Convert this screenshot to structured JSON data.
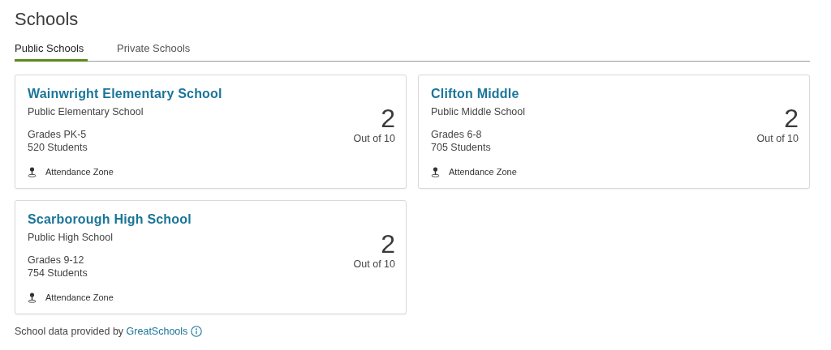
{
  "title": "Schools",
  "tabs": [
    {
      "label": "Public Schools",
      "selected": true
    },
    {
      "label": "Private Schools",
      "selected": false
    }
  ],
  "schools": [
    {
      "name": "Wainwright Elementary School",
      "type": "Public Elementary School",
      "grades": "Grades PK-5",
      "students": "520 Students",
      "zone": "Attendance Zone",
      "rating": "2",
      "rating_caption": "Out of 10"
    },
    {
      "name": "Clifton Middle",
      "type": "Public Middle School",
      "grades": "Grades 6-8",
      "students": "705 Students",
      "zone": "Attendance Zone",
      "rating": "2",
      "rating_caption": "Out of 10"
    },
    {
      "name": "Scarborough High School",
      "type": "Public High School",
      "grades": "Grades 9-12",
      "students": "754 Students",
      "zone": "Attendance Zone",
      "rating": "2",
      "rating_caption": "Out of 10"
    }
  ],
  "footer": {
    "text": "School data provided by",
    "link": "GreatSchools"
  }
}
